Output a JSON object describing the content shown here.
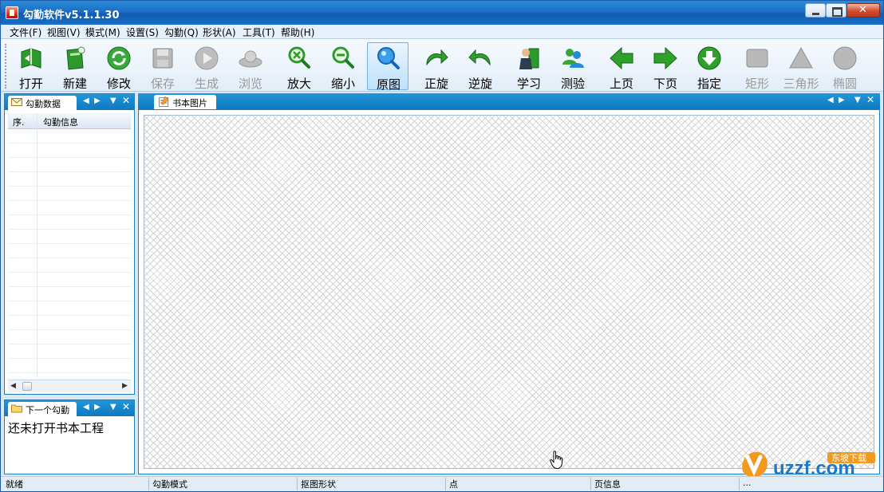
{
  "window": {
    "title": "勾勤软件v5.1.1.30"
  },
  "menu": [
    {
      "label": "文件(F)"
    },
    {
      "label": "视图(V)"
    },
    {
      "label": "模式(M)"
    },
    {
      "label": "设置(S)"
    },
    {
      "label": "勾勤(Q)"
    },
    {
      "label": "形状(A)"
    },
    {
      "label": "工具(T)"
    },
    {
      "label": "帮助(H)"
    }
  ],
  "toolbar": [
    {
      "label": "打开",
      "icon": "open-book-icon",
      "enabled": true
    },
    {
      "label": "新建",
      "icon": "new-book-icon",
      "enabled": true
    },
    {
      "label": "修改",
      "icon": "modify-refresh-icon",
      "enabled": true
    },
    {
      "label": "保存",
      "icon": "floppy-save-icon",
      "enabled": false
    },
    {
      "label": "生成",
      "icon": "generate-play-icon",
      "enabled": false
    },
    {
      "label": "浏览",
      "icon": "browse-saucer-icon",
      "enabled": false
    },
    {
      "label": "放大",
      "icon": "zoom-in-icon",
      "enabled": true
    },
    {
      "label": "缩小",
      "icon": "zoom-out-icon",
      "enabled": true
    },
    {
      "label": "原图",
      "icon": "original-size-icon",
      "enabled": true,
      "active": true
    },
    {
      "label": "正旋",
      "icon": "rotate-clockwise-icon",
      "enabled": true
    },
    {
      "label": "逆旋",
      "icon": "rotate-counterclockwise-icon",
      "enabled": true
    },
    {
      "label": "学习",
      "icon": "learn-person-icon",
      "enabled": true
    },
    {
      "label": "测验",
      "icon": "test-users-icon",
      "enabled": true
    },
    {
      "label": "上页",
      "icon": "arrow-left-icon",
      "enabled": true
    },
    {
      "label": "下页",
      "icon": "arrow-right-icon",
      "enabled": true
    },
    {
      "label": "指定",
      "icon": "arrow-down-circle-icon",
      "enabled": true
    },
    {
      "label": "矩形",
      "icon": "rectangle-icon",
      "enabled": false
    },
    {
      "label": "三角形",
      "icon": "triangle-icon",
      "enabled": false
    },
    {
      "label": "椭圆",
      "icon": "ellipse-icon",
      "enabled": false
    }
  ],
  "left_top_panel": {
    "tab_label": "勾勤数据",
    "columns": [
      "序.",
      "勾勤信息"
    ]
  },
  "left_bottom_panel": {
    "tab_label": "下一个勾勤",
    "message": "还未打开书本工程"
  },
  "main_panel": {
    "tab_label": "书本图片"
  },
  "statusbar": [
    {
      "label": "就绪"
    },
    {
      "label": "勾勤模式"
    },
    {
      "label": "抠图形状"
    },
    {
      "label": "点"
    },
    {
      "label": "页信息"
    },
    {
      "label": "..."
    }
  ],
  "watermark": {
    "text": "uzzf.com",
    "tag": "东坡下载"
  },
  "colors": {
    "title_blue": "#1b6fc4",
    "panel_blue": "#0e78c0",
    "accent_green": "#2ea12a"
  }
}
